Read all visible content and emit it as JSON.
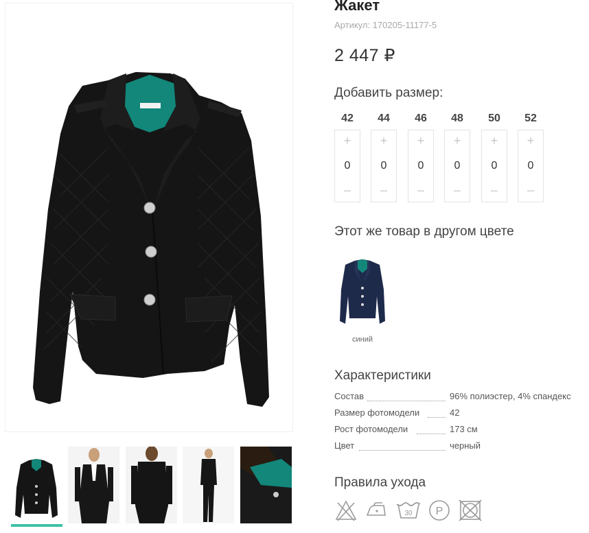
{
  "product": {
    "title": "Жакет",
    "sku": "Артикул: 170205-11177-5",
    "price": "2 447 ₽"
  },
  "sizes": {
    "heading": "Добавить размер:",
    "plus": "+",
    "minus": "–",
    "items": [
      {
        "size": "42",
        "qty": "0"
      },
      {
        "size": "44",
        "qty": "0"
      },
      {
        "size": "46",
        "qty": "0"
      },
      {
        "size": "48",
        "qty": "0"
      },
      {
        "size": "50",
        "qty": "0"
      },
      {
        "size": "52",
        "qty": "0"
      }
    ]
  },
  "other_colors": {
    "heading": "Этот же товар в другом цвете",
    "items": [
      {
        "label": "синий",
        "color": "#1e2a4a"
      }
    ]
  },
  "characteristics": {
    "heading": "Характеристики",
    "rows": [
      {
        "key": "Состав",
        "value": "96% полиэстер, 4% спандекс"
      },
      {
        "key": "Размер фотомодели",
        "value": "42"
      },
      {
        "key": "Рост фотомодели",
        "value": "173 см"
      },
      {
        "key": "Цвет",
        "value": "черный"
      }
    ]
  },
  "care": {
    "heading": "Правила ухода",
    "icons": [
      "no-bleach-icon",
      "iron-low-icon",
      "wash-30-icon",
      "dry-clean-p-icon",
      "no-tumble-dry-icon"
    ],
    "wash_temp": "30",
    "dry_clean_letter": "P"
  },
  "colors": {
    "accent": "#3ec1a6",
    "jacket": "#141414",
    "lining": "#12877a",
    "navy": "#1e2a4a",
    "icon_gray": "#9a9a9a"
  }
}
